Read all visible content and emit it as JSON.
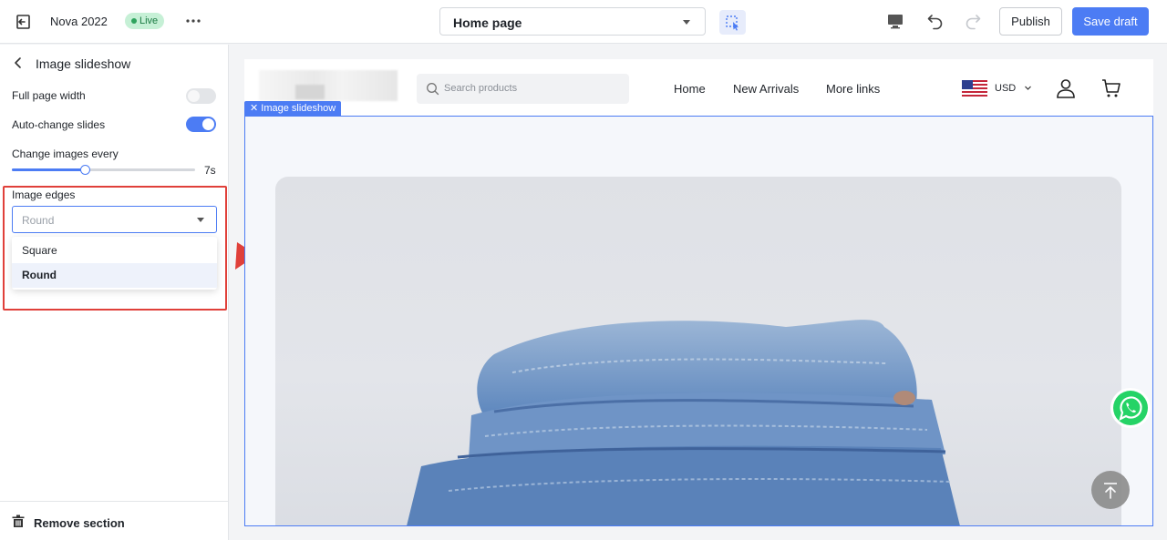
{
  "topbar": {
    "app_title": "Nova 2022",
    "live_badge": "Live",
    "page_selector": "Home page",
    "publish_label": "Publish",
    "save_draft_label": "Save draft"
  },
  "sidebar": {
    "title": "Image slideshow",
    "full_page_width": {
      "label": "Full page width",
      "enabled": false
    },
    "auto_change": {
      "label": "Auto-change slides",
      "enabled": true
    },
    "change_every": {
      "label": "Change images every",
      "value": "7s",
      "slider_fraction": 0.4
    },
    "image_edges": {
      "label": "Image edges",
      "placeholder": "Round",
      "options": [
        "Square",
        "Round"
      ],
      "selected": "Round"
    },
    "remove_label": "Remove section"
  },
  "preview": {
    "search_placeholder": "Search products",
    "nav": [
      "Home",
      "New Arrivals",
      "More links"
    ],
    "currency": "USD",
    "section_tag": "Image slideshow"
  },
  "colors": {
    "accent": "#4c7cf4",
    "live_bg": "#c6f0d6",
    "highlight": "#e0403a",
    "whatsapp": "#25d366"
  },
  "icons": [
    "exit-icon",
    "more-icon",
    "select-mode-icon",
    "desktop-icon",
    "undo-icon",
    "redo-icon",
    "back-icon",
    "trash-icon",
    "search-icon",
    "flag-icon",
    "user-icon",
    "cart-icon",
    "whatsapp-icon",
    "scroll-top-icon"
  ]
}
